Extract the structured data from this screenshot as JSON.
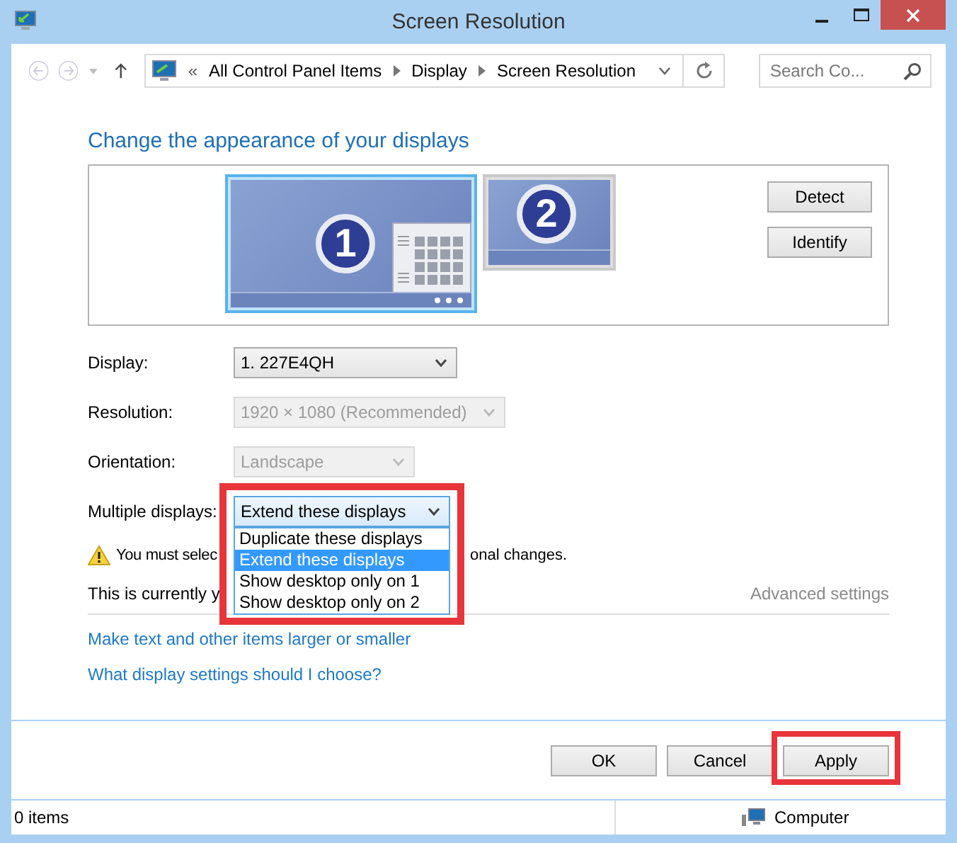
{
  "window": {
    "title": "Screen Resolution"
  },
  "address_bar": {
    "breadcrumbs": [
      "All Control Panel Items",
      "Display",
      "Screen Resolution"
    ],
    "overflow": "«"
  },
  "search": {
    "placeholder": "Search Co..."
  },
  "heading": "Change the appearance of your displays",
  "monitors": [
    {
      "number": "1",
      "selected": true
    },
    {
      "number": "2",
      "selected": false
    }
  ],
  "monitor_buttons": [
    "Detect",
    "Identify"
  ],
  "settings": [
    {
      "label": "Display:",
      "value": "1. 227E4QH",
      "disabled": false,
      "expanded": false
    },
    {
      "label": "Resolution:",
      "value": "1920 × 1080 (Recommended)",
      "disabled": true,
      "expanded": false
    },
    {
      "label": "Orientation:",
      "value": "Landscape",
      "disabled": true,
      "expanded": false
    },
    {
      "label": "Multiple displays:",
      "value": "Extend these displays",
      "disabled": false,
      "expanded": true
    }
  ],
  "dropdown_options": [
    {
      "label": "Duplicate these displays",
      "selected": false
    },
    {
      "label": "Extend these displays",
      "selected": true
    },
    {
      "label": "Show desktop only on 1",
      "selected": false
    },
    {
      "label": "Show desktop only on 2",
      "selected": false
    }
  ],
  "warning": {
    "before": "You must selec",
    "after": "onal changes."
  },
  "current_note": "This is currently y",
  "advanced_link": "Advanced settings",
  "links": [
    "Make text and other items larger or smaller",
    "What display settings should I choose?"
  ],
  "buttons": [
    {
      "label": "OK",
      "highlighted": false
    },
    {
      "label": "Cancel",
      "highlighted": false
    },
    {
      "label": "Apply",
      "highlighted": true
    }
  ],
  "status_bar": {
    "items": "0 items",
    "location": "Computer"
  }
}
